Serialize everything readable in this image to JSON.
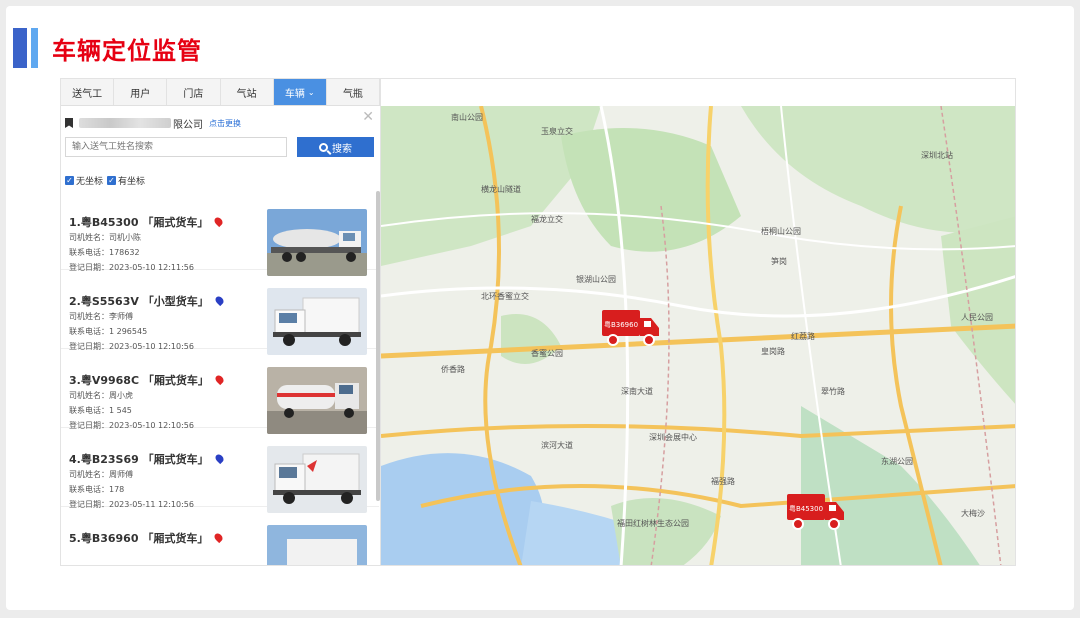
{
  "page_title": "车辆定位监管",
  "colors": {
    "title_red": "#e60012",
    "accent_blue": "#3b63c9",
    "button_blue": "#2f6fcf",
    "truck_red": "#d81e1e"
  },
  "tabs": [
    {
      "label": "送气工",
      "active": false
    },
    {
      "label": "用户",
      "active": false
    },
    {
      "label": "门店",
      "active": false
    },
    {
      "label": "气站",
      "active": false
    },
    {
      "label": "车辆",
      "active": true
    },
    {
      "label": "气瓶",
      "active": false
    }
  ],
  "company": {
    "name_suffix": "限公司",
    "change_link": "点击更换"
  },
  "search": {
    "placeholder": "输入送气工姓名搜索",
    "button_label": "搜索"
  },
  "filters": [
    {
      "label": "无坐标",
      "checked": true
    },
    {
      "label": "有坐标",
      "checked": true
    }
  ],
  "vehicles": [
    {
      "title": "1.粤B45300 「厢式货车」",
      "pin": "red",
      "driver": "司机姓名：司机小陈",
      "phone": "联系电话：178632",
      "date": "登记日期：2023-05-10 12:11:56"
    },
    {
      "title": "2.粤S5563V 「小型货车」",
      "pin": "blue",
      "driver": "司机姓名：李师傅",
      "phone": "联系电话：1 296545",
      "date": "登记日期：2023-05-10 12:10:56"
    },
    {
      "title": "3.粤V9968C 「厢式货车」",
      "pin": "red",
      "driver": "司机姓名：周小虎",
      "phone": "联系电话：1 545",
      "date": "登记日期：2023-05-10 12:10:56"
    },
    {
      "title": "4.粤B23S69 「厢式货车」",
      "pin": "blue",
      "driver": "司机姓名：周师傅",
      "phone": "联系电话：178",
      "date": "登记日期：2023-05-11 12:10:56"
    },
    {
      "title": "5.粤B36960 「厢式货车」",
      "pin": "red",
      "driver": "",
      "phone": "",
      "date": ""
    }
  ],
  "map": {
    "trucks": [
      {
        "plate": "粤B36960"
      },
      {
        "plate": "粤B45300"
      }
    ],
    "labels": [
      "南山公园",
      "玉泉立交",
      "横龙山隧道",
      "福龙立交",
      "梧桐山公园",
      "银湖山公园",
      "香蜜公园",
      "侨香路",
      "深南大道",
      "滨河大道",
      "深圳会展中心",
      "福田红树林生态公园",
      "红荔路",
      "皇岗路",
      "笋岗",
      "福强路",
      "北环香蜜立交",
      "翠竹路",
      "东湖公园",
      "大梅沙",
      "人民公园",
      "深圳北站"
    ]
  }
}
